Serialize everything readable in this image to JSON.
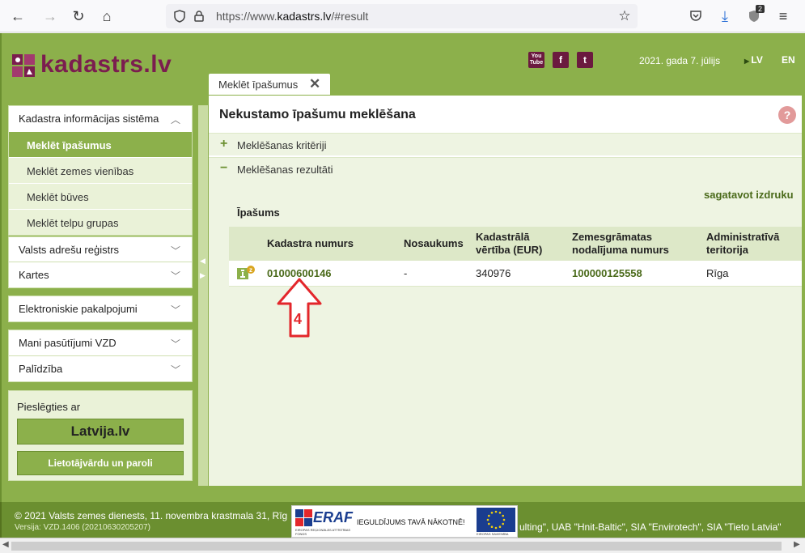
{
  "browser": {
    "url_prefix": "https://www.",
    "url_host": "kadastrs.lv",
    "url_suffix": "/#result",
    "shield_badge": "2"
  },
  "header": {
    "logo_text": "kadastrs.lv",
    "social": [
      "You Tube",
      "f",
      "t"
    ],
    "date": "2021. gada 7. jūlijs",
    "lang_lv": "LV",
    "lang_en": "EN"
  },
  "tab": {
    "label": "Meklēt īpašumus",
    "close": "✕"
  },
  "sidebar": {
    "groups": [
      {
        "title": "Kadastra informācijas sistēma",
        "chev": "︿",
        "items": [
          "Meklēt īpašumus",
          "Meklēt zemes vienības",
          "Meklēt būves",
          "Meklēt telpu grupas"
        ]
      },
      {
        "title": "Valsts adrešu reģistrs",
        "chev": "﹀"
      },
      {
        "title": "Kartes",
        "chev": "﹀"
      },
      {
        "title": "Elektroniskie pakalpojumi",
        "chev": "﹀"
      },
      {
        "title": "Mani pasūtījumi VZD",
        "chev": "﹀"
      },
      {
        "title": "Palīdzība",
        "chev": "﹀"
      }
    ],
    "login_title": "Pieslēgties ar",
    "latvija_label": "Latvija.lv",
    "password_label": "Lietotājvārdu un paroli"
  },
  "content": {
    "title": "Nekustamo īpašumu meklēšana",
    "help": "?",
    "criteria_sign": "+",
    "criteria_label": "Meklēšanas kritēriji",
    "results_sign": "−",
    "results_label": "Meklēšanas rezultāti",
    "print_link": "sagatavot izdruku",
    "group_label": "Īpašums",
    "table": {
      "headers": [
        "Kadastra numurs",
        "Nosaukums",
        "Kadastrālā vērtība (EUR)",
        "Zemesgrāmatas nodalījuma numurs",
        "Administratīvā teritorija"
      ],
      "headers_split": {
        "value_1": "Kadastrālā",
        "value_2": "vērtība (EUR)",
        "gram_1": "Zemesgrāmatas",
        "gram_2": "nodalījuma numurs",
        "admin_1": "Administratīvā",
        "admin_2": "teritorija"
      },
      "rows": [
        {
          "kadastra_numurs": "01000600146",
          "nosaukums": "-",
          "vertiba": "340976",
          "zemesgramata": "100000125558",
          "teritorija": "Rīga"
        }
      ]
    }
  },
  "annotation": {
    "number": "4"
  },
  "footer": {
    "line1": "© 2021 Valsts zemes dienests, 11. novembra krastmala 31, Rīg",
    "line2": "Versija: VZD.1406 (20210630205207)",
    "right": "ulting\", UAB \"Hnit-Baltic\", SIA \"Envirotech\", SIA \"Tieto Latvia\"",
    "eraf_logo": "ERAF",
    "eraf_sub": "EIROPAS REĢIONĀLĀS ATTĪSTĪBAS FONDS",
    "eraf_slogan": "IEGULDĪJUMS TAVĀ NĀKOTNĒ!",
    "eu_label": "EIROPAS SAVIENĪBA"
  },
  "colors": {
    "brand_green": "#8cb04b",
    "brand_maroon": "#7b1d4f",
    "annotation_red": "#e3262b"
  }
}
